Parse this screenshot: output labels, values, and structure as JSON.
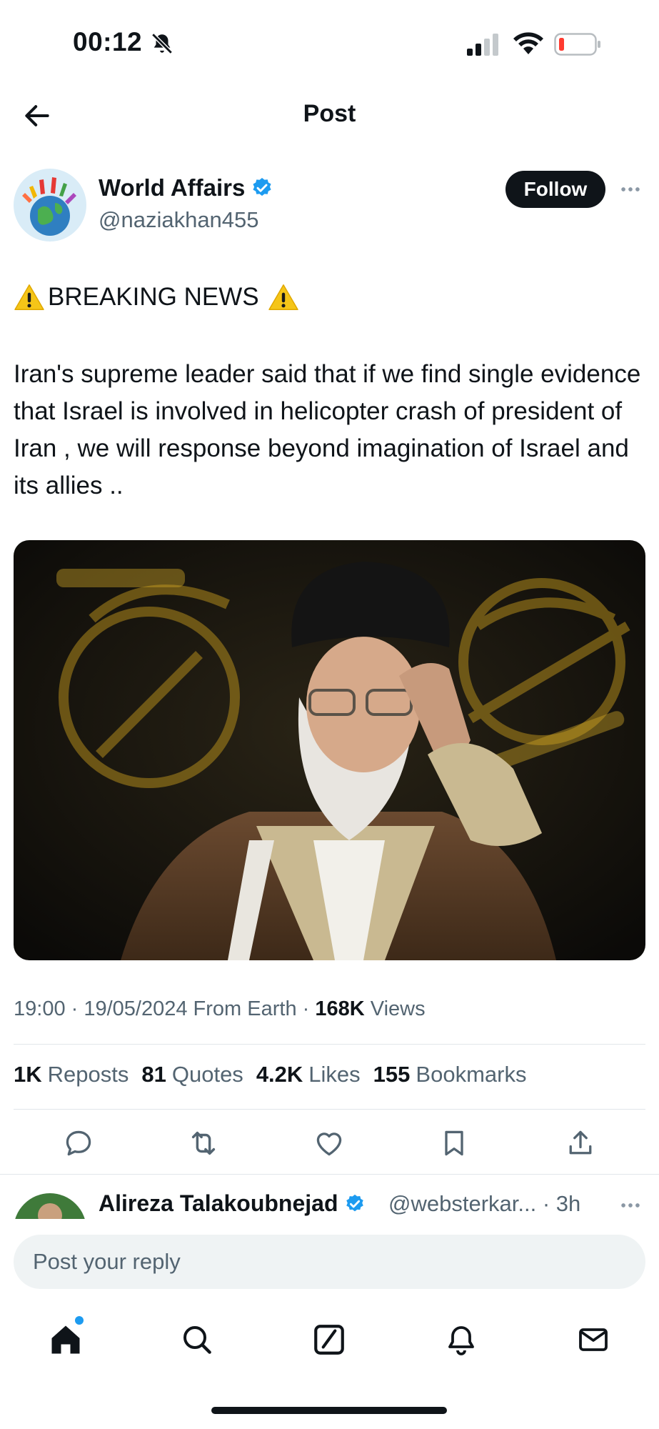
{
  "status_bar": {
    "time": "00:12"
  },
  "header": {
    "title": "Post"
  },
  "post": {
    "author_name": "World Affairs",
    "author_handle": "@naziakhan455",
    "follow_label": "Follow",
    "headline": "BREAKING NEWS",
    "body": "Iran's supreme leader said that if we find single evidence that Israel is involved in helicopter crash of president of Iran , we will response beyond imagination of Israel and its allies ..",
    "meta": {
      "time_date": "19:00 · 19/05/2024 From Earth ·",
      "views_count": "168K",
      "views_label": "Views"
    },
    "stats": [
      {
        "count": "1K",
        "label": "Reposts"
      },
      {
        "count": "81",
        "label": "Quotes"
      },
      {
        "count": "4.2K",
        "label": "Likes"
      },
      {
        "count": "155",
        "label": "Bookmarks"
      }
    ],
    "actions": [
      "reply-icon",
      "repost-icon",
      "like-icon",
      "bookmark-icon",
      "share-icon"
    ]
  },
  "reply_preview": {
    "name": "Alireza Talakoubnejad",
    "handle_time": "@websterkar... · 3h"
  },
  "compose": {
    "placeholder": "Post your reply"
  },
  "bottom_nav": [
    "home-icon",
    "search-icon",
    "grok-icon",
    "notifications-icon",
    "messages-icon"
  ],
  "colors": {
    "text": "#0f1419",
    "secondary": "#536471",
    "verified": "#1d9bf0",
    "accent_dot": "#1d9bf0"
  }
}
